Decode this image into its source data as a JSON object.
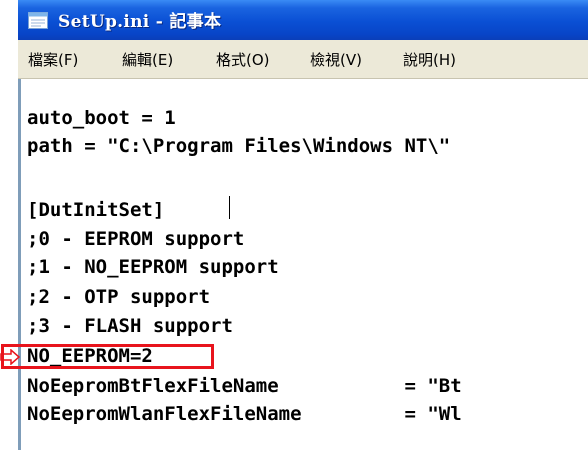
{
  "window": {
    "title": "SetUp.ini - 記事本",
    "icon": "notepad-icon"
  },
  "menu": [
    {
      "label": "檔案(F)"
    },
    {
      "label": "編輯(E)"
    },
    {
      "label": "格式(O)"
    },
    {
      "label": "檢視(V)"
    },
    {
      "label": "說明(H)"
    }
  ],
  "content": {
    "lines": [
      "auto_boot = 1",
      "path = \"C:\\Program Files\\Windows NT\\\"",
      "",
      "[DutInitSet]",
      ";0 - EEPROM support",
      ";1 - NO_EEPROM support",
      ";2 - OTP support",
      ";3 - FLASH support",
      "NO_EEPROM=2",
      "NoEepromBtFlexFileName           = \"Bt",
      "NoEepromWlanFlexFileName         = \"Wl"
    ]
  },
  "annotation": {
    "highlight_color": "#e8141c",
    "highlighted_line": "NO_EEPROM=2",
    "arrow_icon": "pointer-arrow-icon"
  }
}
